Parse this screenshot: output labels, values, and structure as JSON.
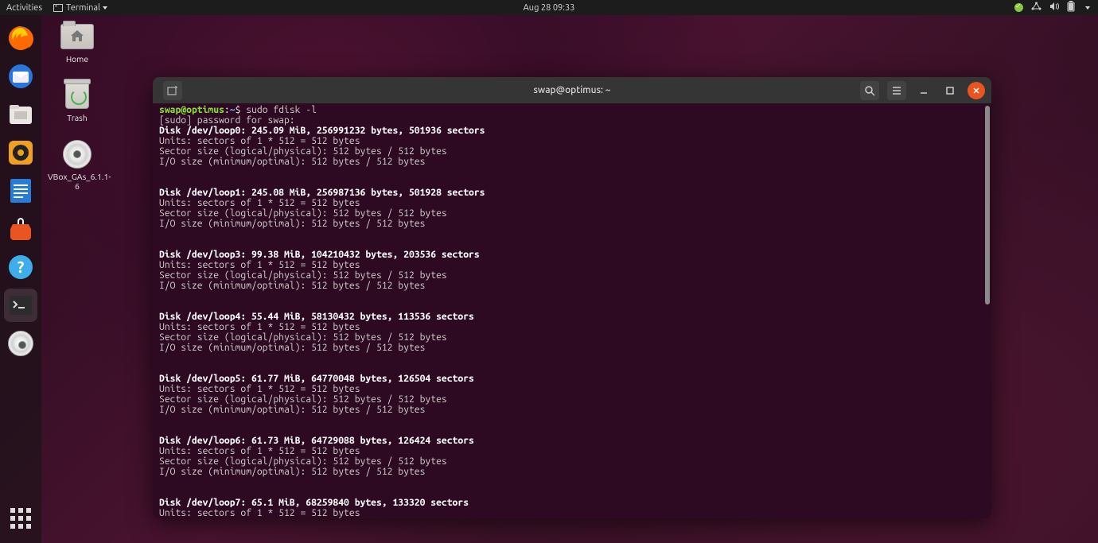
{
  "panel": {
    "activities": "Activities",
    "app_indicator": "Terminal",
    "clock": "Aug 28  09:33"
  },
  "desktop_icons": {
    "home": "Home",
    "trash": "Trash",
    "vbox": "VBox_GAs_6.1.1-6"
  },
  "terminal": {
    "title": "swap@optimus: ~",
    "prompt_user": "swap@optimus",
    "prompt_sep": ":",
    "prompt_path": "~",
    "prompt_dollar": "$ ",
    "command": "sudo fdisk -l",
    "sudo_line": "[sudo] password for swap:",
    "units_line": "Units: sectors of 1 * 512 = 512 bytes",
    "sector_line": "Sector size (logical/physical): 512 bytes / 512 bytes",
    "io_line": "I/O size (minimum/optimal): 512 bytes / 512 bytes",
    "disks": [
      {
        "header": "Disk /dev/loop0: 245.09 MiB, 256991232 bytes, 501936 sectors"
      },
      {
        "header": "Disk /dev/loop1: 245.08 MiB, 256987136 bytes, 501928 sectors"
      },
      {
        "header": "Disk /dev/loop3: 99.38 MiB, 104210432 bytes, 203536 sectors"
      },
      {
        "header": "Disk /dev/loop4: 55.44 MiB, 58130432 bytes, 113536 sectors"
      },
      {
        "header": "Disk /dev/loop5: 61.77 MiB, 64770048 bytes, 126504 sectors"
      },
      {
        "header": "Disk /dev/loop6: 61.73 MiB, 64729088 bytes, 126424 sectors"
      },
      {
        "header": "Disk /dev/loop7: 65.1 MiB, 68259840 bytes, 133320 sectors"
      }
    ]
  }
}
